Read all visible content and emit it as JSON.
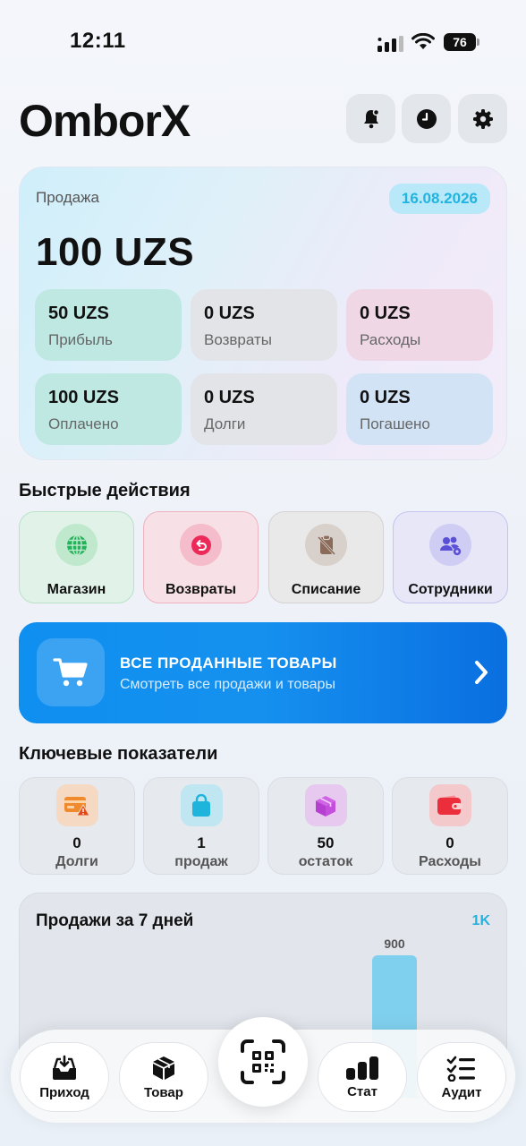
{
  "status_bar": {
    "time": "12:11",
    "battery": "76"
  },
  "header": {
    "title": "OmborX"
  },
  "summary": {
    "label": "Продажа",
    "date": "16.08.2026",
    "total": "100 UZS",
    "tiles": [
      {
        "value": "50 UZS",
        "label": "Прибыль"
      },
      {
        "value": "0 UZS",
        "label": "Возвраты"
      },
      {
        "value": "0 UZS",
        "label": "Расходы"
      },
      {
        "value": "100 UZS",
        "label": "Оплачено"
      },
      {
        "value": "0 UZS",
        "label": "Долги"
      },
      {
        "value": "0 UZS",
        "label": "Погашено"
      }
    ]
  },
  "quick_actions": {
    "title": "Быстрые действия",
    "items": [
      {
        "label": "Магазин",
        "icon": "globe-icon"
      },
      {
        "label": "Возвраты",
        "icon": "return-icon"
      },
      {
        "label": "Списание",
        "icon": "clipboard-off-icon"
      },
      {
        "label": "Сотрудники",
        "icon": "users-gear-icon"
      }
    ]
  },
  "banner": {
    "title": "ВСЕ ПРОДАННЫЕ ТОВАРЫ",
    "subtitle": "Смотреть все продажи и товары"
  },
  "key_metrics": {
    "title": "Ключевые показатели",
    "items": [
      {
        "value": "0",
        "label": "Долги",
        "icon": "card-warning-icon"
      },
      {
        "value": "1",
        "label": "продаж",
        "icon": "shopping-bag-icon"
      },
      {
        "value": "50",
        "label": "остаток",
        "icon": "box-icon"
      },
      {
        "value": "0",
        "label": "Расходы",
        "icon": "wallet-icon"
      }
    ]
  },
  "chart": {
    "title": "Продажи за 7 дней",
    "max_label": "1K"
  },
  "chart_data": {
    "type": "bar",
    "title": "Продажи за 7 дней",
    "values": [
      900
    ],
    "value_labels": [
      "900"
    ],
    "ylim": [
      0,
      1000
    ],
    "bar_color": "#7fd0ee"
  },
  "bottom_nav": {
    "items": [
      {
        "label": "Приход",
        "icon": "inbox-download-icon"
      },
      {
        "label": "Товар",
        "icon": "package-icon"
      },
      {
        "label": "Стат",
        "icon": "bar-chart-icon"
      },
      {
        "label": "Аудит",
        "icon": "checklist-icon"
      }
    ],
    "scan": "qr-scan-icon"
  }
}
